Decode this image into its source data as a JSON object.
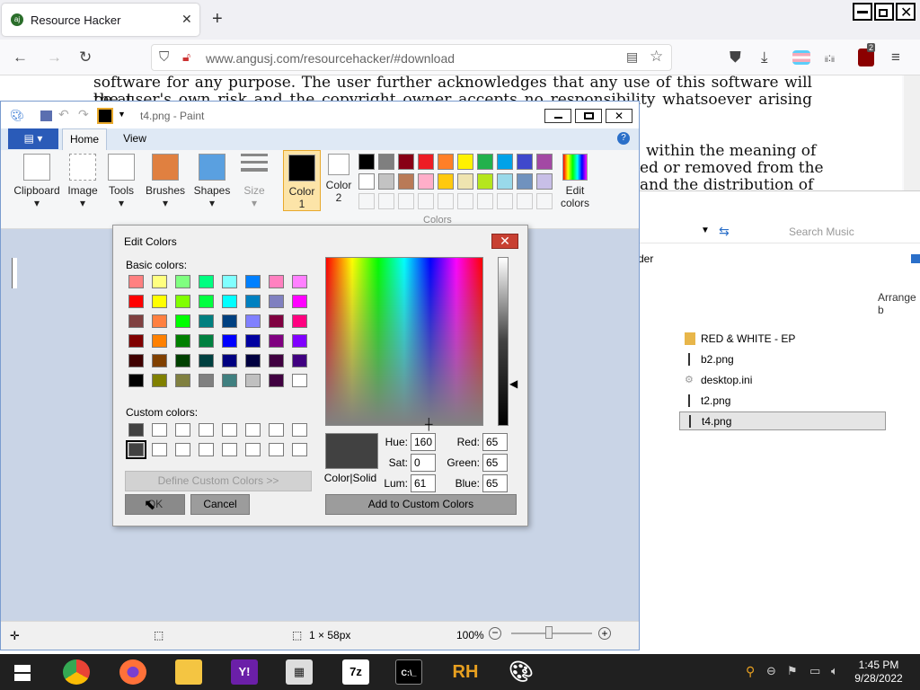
{
  "browser": {
    "tab_title": "Resource Hacker",
    "url": "www.angusj.com/resourcehacker/#download",
    "page_lines": [
      "software for any purpose. The user further acknowledges that any use of this software will be at",
      "the user's own risk and the copyright owner accepts no responsibility whatsoever arising from the",
      "within the meaning of",
      "ed or removed from the",
      "and the distribution of"
    ],
    "ext_badge": "2"
  },
  "explorer": {
    "search_placeholder": "Search Music",
    "header_partial": "der",
    "arrange": "Arrange b",
    "items": [
      "RED & WHITE - EP",
      "b2.png",
      "desktop.ini",
      "t2.png",
      "t4.png"
    ]
  },
  "paint": {
    "title": "t4.png - Paint",
    "tabs": [
      "Home",
      "View"
    ],
    "ribbon": {
      "clipboard": "Clipboard",
      "image": "Image",
      "tools": "Tools",
      "brushes": "Brushes",
      "shapes": "Shapes",
      "size": "Size",
      "color1_a": "Color",
      "color1_b": "1",
      "color2_a": "Color",
      "color2_b": "2",
      "edit_a": "Edit",
      "edit_b": "colors",
      "colors_group": "Colors"
    },
    "palette_row1": [
      "#000000",
      "#7f7f7f",
      "#880015",
      "#ed1c24",
      "#ff7f27",
      "#fff200",
      "#22b14c",
      "#00a2e8",
      "#3f48cc",
      "#a349a4"
    ],
    "palette_row2": [
      "#ffffff",
      "#c3c3c3",
      "#b97a57",
      "#ffaec9",
      "#ffc90e",
      "#efe4b0",
      "#b5e61d",
      "#99d9ea",
      "#7092be",
      "#c8bfe7"
    ],
    "status": {
      "dimensions": "1 × 58px",
      "zoom": "100%"
    }
  },
  "dialog": {
    "title": "Edit Colors",
    "basic_label": "Basic colors:",
    "custom_label": "Custom colors:",
    "define_btn": "Define Custom Colors >>",
    "ok": "OK",
    "cancel": "Cancel",
    "add_btn": "Add to Custom Colors",
    "color_solid": "Color|Solid",
    "hue_label": "Hue:",
    "hue": "160",
    "sat_label": "Sat:",
    "sat": "0",
    "lum_label": "Lum:",
    "lum": "61",
    "red_label": "Red:",
    "red": "65",
    "green_label": "Green:",
    "green": "65",
    "blue_label": "Blue:",
    "blue": "65",
    "preview_color": "#414141",
    "basic_colors": [
      [
        "#ff8080",
        "#ffff80",
        "#80ff80",
        "#00ff80",
        "#80ffff",
        "#0080ff",
        "#ff80c0",
        "#ff80ff"
      ],
      [
        "#ff0000",
        "#ffff00",
        "#80ff00",
        "#00ff40",
        "#00ffff",
        "#0080c0",
        "#8080c0",
        "#ff00ff"
      ],
      [
        "#804040",
        "#ff8040",
        "#00ff00",
        "#008080",
        "#004080",
        "#8080ff",
        "#800040",
        "#ff0080"
      ],
      [
        "#800000",
        "#ff8000",
        "#008000",
        "#008040",
        "#0000ff",
        "#0000a0",
        "#800080",
        "#8000ff"
      ],
      [
        "#400000",
        "#804000",
        "#004000",
        "#004040",
        "#000080",
        "#000040",
        "#400040",
        "#400080"
      ],
      [
        "#000000",
        "#808000",
        "#808040",
        "#808080",
        "#408080",
        "#c0c0c0",
        "#400040",
        "#ffffff"
      ]
    ],
    "custom_colors": [
      [
        "#414141",
        "#ffffff",
        "#ffffff",
        "#ffffff",
        "#ffffff",
        "#ffffff",
        "#ffffff",
        "#ffffff"
      ],
      [
        "#414141",
        "#ffffff",
        "#ffffff",
        "#ffffff",
        "#ffffff",
        "#ffffff",
        "#ffffff",
        "#ffffff"
      ]
    ]
  },
  "taskbar": {
    "time": "1:45 PM",
    "date": "9/28/2022",
    "apps": [
      "windows-start",
      "chrome",
      "firefox",
      "file-explorer",
      "yahoo",
      "calculator",
      "7zip",
      "cmd",
      "resource-hacker",
      "paint"
    ]
  }
}
